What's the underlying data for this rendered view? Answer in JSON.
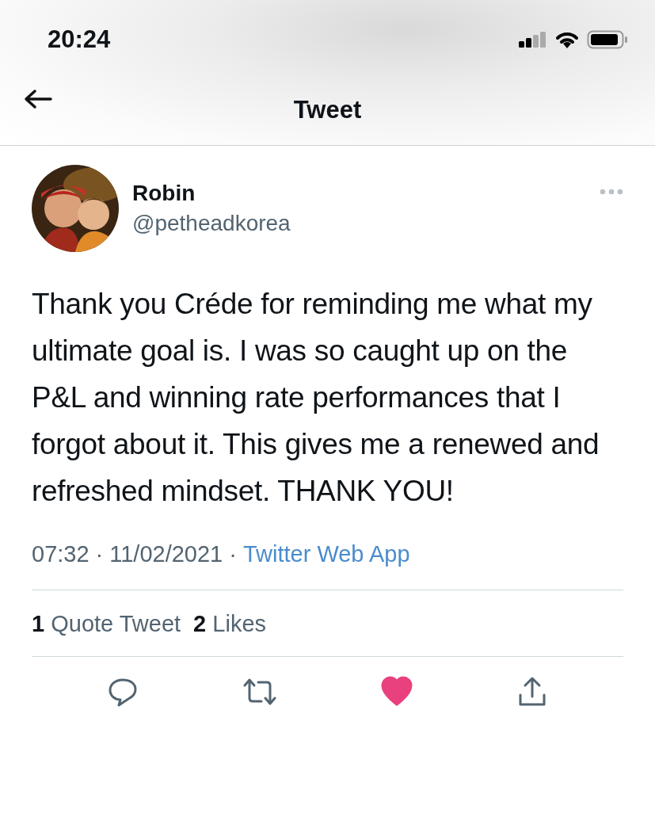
{
  "status_bar": {
    "time": "20:24"
  },
  "header": {
    "title": "Tweet"
  },
  "tweet": {
    "author": {
      "name": "Robin",
      "handle": "@petheadkorea"
    },
    "text": "Thank you Créde for reminding me what my ultimate goal is. I was so caught up on the P&L and winning rate performances that I forgot about it. This gives me a renewed and refreshed mindset. THANK YOU!",
    "meta": [
      "07:32",
      "·",
      "11/02/2021",
      "·"
    ],
    "source": "Twitter Web App",
    "stats": [
      {
        "count": "1",
        "label": "Quote Tweet"
      },
      {
        "count": "2",
        "label": "Likes"
      }
    ],
    "liked": true,
    "actions": [
      {
        "kind": "reply"
      },
      {
        "kind": "retweet"
      },
      {
        "kind": "like"
      },
      {
        "kind": "share"
      }
    ]
  }
}
